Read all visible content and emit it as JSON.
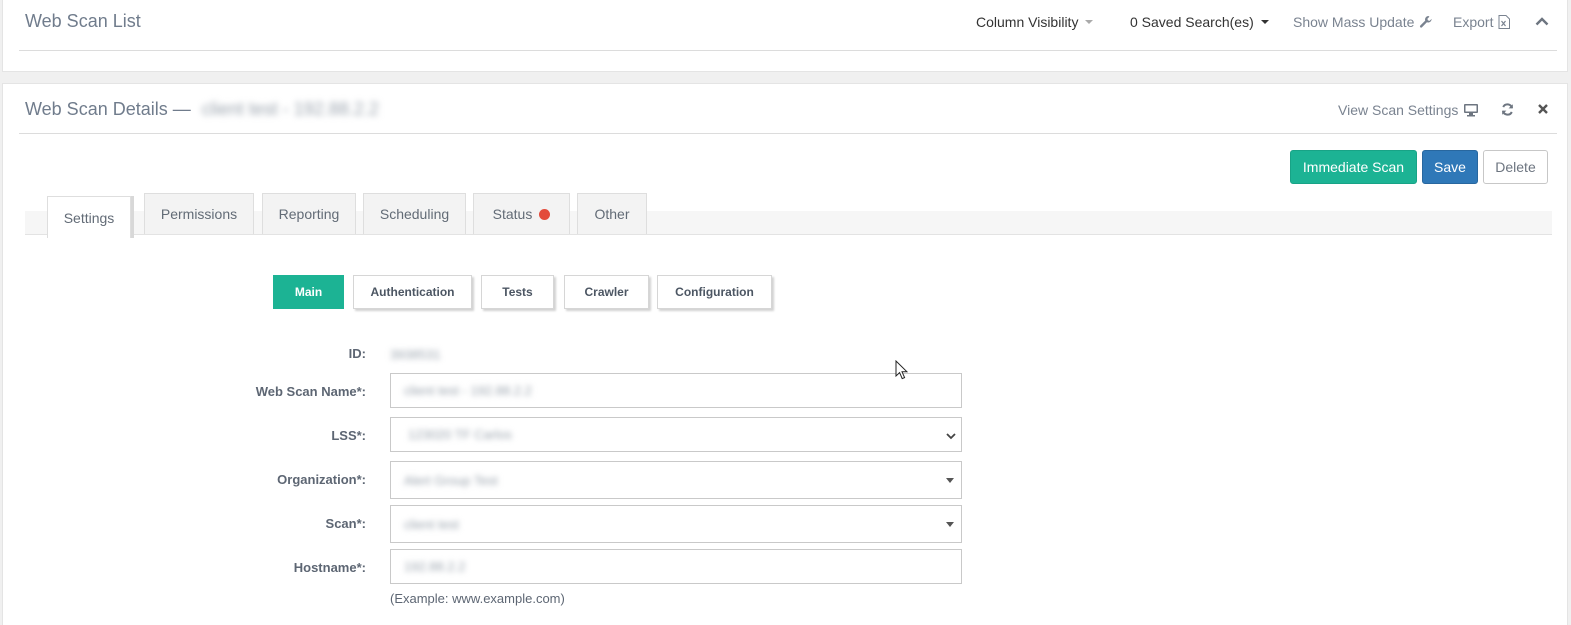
{
  "list_panel": {
    "title": "Web Scan List",
    "column_visibility": "Column Visibility",
    "saved_searches": "0 Saved Search(es)",
    "mass_update": "Show Mass Update",
    "export": "Export"
  },
  "details_panel": {
    "title": "Web Scan Details —",
    "title_target": "client test - 192.88.2.2",
    "view_settings": "View Scan Settings",
    "buttons": {
      "immediate_scan": "Immediate Scan",
      "save": "Save",
      "delete": "Delete"
    },
    "tabs": [
      "Settings",
      "Permissions",
      "Reporting",
      "Scheduling",
      "Status",
      "Other"
    ],
    "active_tab": "Settings",
    "subtabs": [
      "Main",
      "Authentication",
      "Tests",
      "Crawler",
      "Configuration"
    ],
    "active_subtab": "Main",
    "form": {
      "id_label": "ID:",
      "id_value": "3938531",
      "name_label": "Web Scan Name*:",
      "name_value": "client test - 192.88.2.2",
      "lss_label": "LSS*:",
      "lss_value": "123020 TF Carlos",
      "org_label": "Organization*:",
      "org_value": "Alert Group Test",
      "scan_label": "Scan*:",
      "scan_value": "client test",
      "hostname_label": "Hostname*:",
      "hostname_value": "192.88.2.2",
      "hostname_hint": "(Example: www.example.com)"
    }
  },
  "colors": {
    "teal": "#1cb394",
    "blue": "#2f78b8",
    "status_red": "#e34b3b"
  }
}
